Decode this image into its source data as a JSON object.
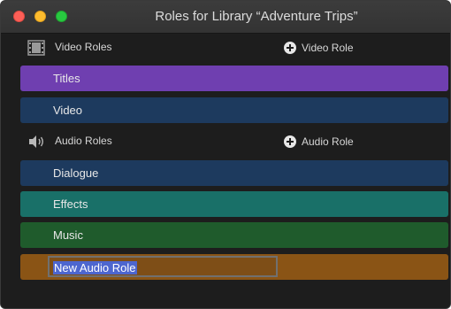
{
  "window": {
    "title": "Roles for Library “Adventure Trips”"
  },
  "video_section": {
    "label": "Video Roles",
    "icon": "film-strip-icon",
    "add_label": "Video Role",
    "roles": [
      {
        "label": "Titles",
        "color": "#6f3fb0"
      },
      {
        "label": "Video",
        "color": "#1d3a5e"
      }
    ]
  },
  "audio_section": {
    "label": "Audio Roles",
    "icon": "speaker-icon",
    "add_label": "Audio Role",
    "roles": [
      {
        "label": "Dialogue",
        "color": "#1d3a5e"
      },
      {
        "label": "Effects",
        "color": "#197068"
      },
      {
        "label": "Music",
        "color": "#1f5b2c"
      }
    ],
    "new_role": {
      "value": "New Audio Role",
      "color": "#8a5415",
      "selected": true
    }
  }
}
